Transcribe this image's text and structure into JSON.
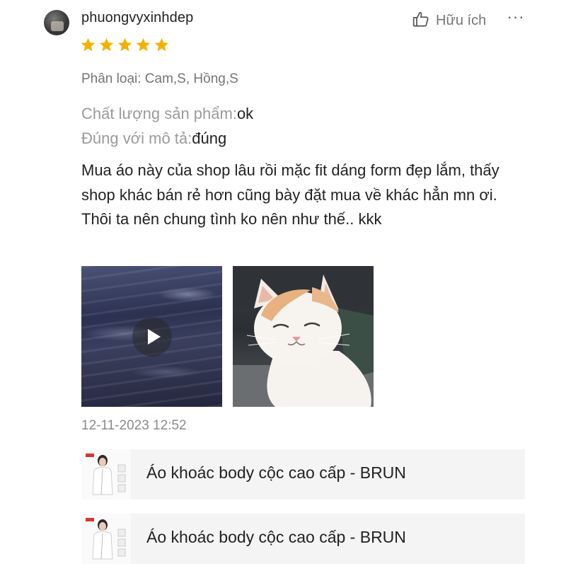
{
  "review": {
    "username": "phuongvyxinhdep",
    "rating": 5,
    "helpful_label": "Hữu ích",
    "more_label": "···",
    "variation": "Phân loại: Cam,S, Hồng,S",
    "attributes": [
      {
        "label": "Chất lượng sản phẩm:",
        "value": "ok"
      },
      {
        "label": "Đúng với mô tả:",
        "value": "đúng"
      }
    ],
    "comment": "Mua áo này của shop lâu rồi mặc fit dáng form đẹp lắm, thấy shop khác bán rẻ hơn cũng bày đặt mua về khác hẳn mn ơi. Thôi ta nên chung tình ko nên như thế.. kkk",
    "media": [
      {
        "type": "video",
        "icon": "play-icon"
      },
      {
        "type": "image"
      }
    ],
    "timestamp": "12-11-2023 12:52"
  },
  "products": [
    {
      "name": "Áo khoác body cộc cao cấp - BRUN"
    },
    {
      "name": "Áo khoác body cộc cao cấp - BRUN"
    }
  ],
  "colors": {
    "star": "#F5B100",
    "text_primary": "#222222",
    "text_secondary": "#757575",
    "product_bg": "#F4F4F4"
  }
}
